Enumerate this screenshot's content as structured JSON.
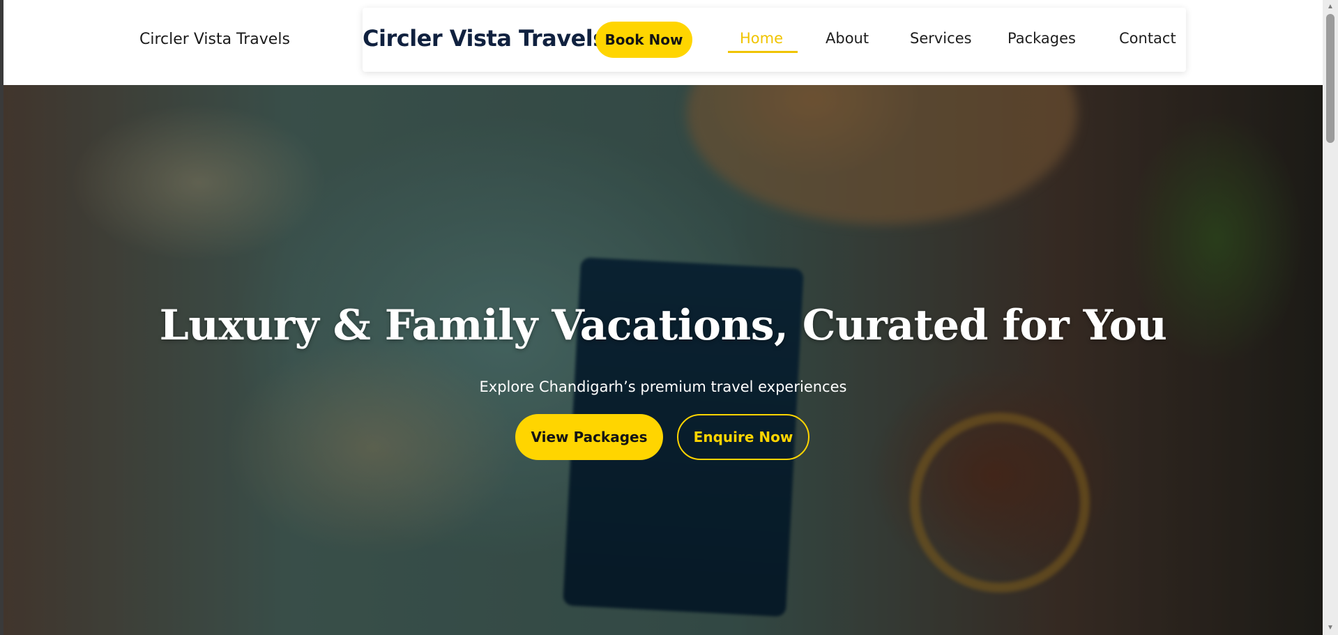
{
  "header": {
    "site_name": "Circler Vista Travels",
    "brand": "Circler Vista Travels",
    "book_button": "Book Now",
    "nav": [
      {
        "label": "Home",
        "active": true
      },
      {
        "label": "About",
        "active": false
      },
      {
        "label": "Services",
        "active": false
      },
      {
        "label": "Packages",
        "active": false
      },
      {
        "label": "Contact",
        "active": false
      }
    ]
  },
  "hero": {
    "title": "Luxury & Family Vacations, Curated for You",
    "subtitle": "Explore Chandigarh’s premium travel experiences",
    "primary_button": "View Packages",
    "secondary_button": "Enquire Now"
  },
  "scrollbar": {
    "up_icon": "▲",
    "down_icon": "▼"
  },
  "colors": {
    "accent": "#ffd500",
    "brand": "#10213f",
    "active_nav": "#f0c400"
  }
}
